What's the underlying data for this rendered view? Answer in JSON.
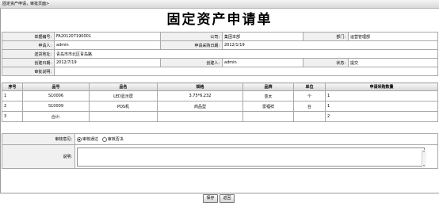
{
  "breadcrumb": "固定资产申请，审批页面>",
  "form_title": "固定资产申请单",
  "header_fields": {
    "doc_no_label": "单据编号:",
    "doc_no": "FA201207190001",
    "company_label": "公司:",
    "company": "集团本部",
    "dept_label": "部门:",
    "dept": "运营管理部",
    "applicant_label": "申请人:",
    "applicant": "admin",
    "purchase_date_label": "申请采购日期:",
    "purchase_date": "2012/1/19",
    "address_label": "送货地址:",
    "address": "青岛市市北区青岛路",
    "created_date_label": "创建日期:",
    "created_date": "2012/7/19",
    "creator_label": "创建人:",
    "creator": "admin",
    "status_label": "状态:",
    "status": "提交",
    "remark_label": "审批说明:",
    "remark": ""
  },
  "table": {
    "columns": [
      "序号",
      "品号",
      "品名",
      "规格",
      "品牌",
      "单位",
      "申请采购数量"
    ],
    "rows": [
      [
        "1",
        "S10006",
        "LED显示屏",
        "3.75*6.232",
        "亚太",
        "个",
        "1"
      ],
      [
        "2",
        "S10009",
        "POS机",
        "商品型",
        "雷福祥",
        "台",
        "1"
      ],
      [
        "3",
        "合计:",
        "",
        "",
        "",
        "",
        "2"
      ]
    ]
  },
  "approval": {
    "opinion_label": "审核意见:",
    "approve_label": "审核通过",
    "reject_label": "审核否决",
    "note_label": "说明:",
    "note_value": ""
  },
  "buttons": {
    "save": "保存",
    "back": "返回"
  }
}
